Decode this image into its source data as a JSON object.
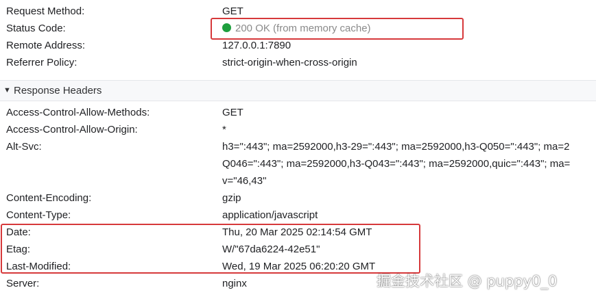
{
  "general": {
    "request_method": {
      "key": "Request Method:",
      "value": "GET"
    },
    "status_code": {
      "key": "Status Code:",
      "value": "200 OK (from memory cache)",
      "status_color": "#1e9f3e"
    },
    "remote_address": {
      "key": "Remote Address:",
      "value": "127.0.0.1:7890"
    },
    "referrer_policy": {
      "key": "Referrer Policy:",
      "value": "strict-origin-when-cross-origin"
    }
  },
  "response_headers": {
    "title": "Response Headers",
    "toggle_icon": "triangle-down",
    "allow_methods": {
      "key": "Access-Control-Allow-Methods:",
      "value": "GET"
    },
    "allow_origin": {
      "key": "Access-Control-Allow-Origin:",
      "value": "*"
    },
    "alt_svc": {
      "key": "Alt-Svc:",
      "lines": [
        "h3=\":443\"; ma=2592000,h3-29=\":443\"; ma=2592000,h3-Q050=\":443\"; ma=2",
        "Q046=\":443\"; ma=2592000,h3-Q043=\":443\"; ma=2592000,quic=\":443\"; ma=",
        "v=\"46,43\""
      ]
    },
    "content_encoding": {
      "key": "Content-Encoding:",
      "value": "gzip"
    },
    "content_type": {
      "key": "Content-Type:",
      "value": "application/javascript"
    },
    "date": {
      "key": "Date:",
      "value": "Thu, 20 Mar 2025 02:14:54 GMT"
    },
    "etag": {
      "key": "Etag:",
      "value": "W/\"67da6224-42e51\""
    },
    "last_modified": {
      "key": "Last-Modified:",
      "value": "Wed, 19 Mar 2025 06:20:20 GMT"
    },
    "server": {
      "key": "Server:",
      "value": "nginx"
    }
  },
  "annotation": {
    "highlight_color": "#d6383a"
  },
  "watermark": {
    "text": "掘金技术社区 @ puppy0_0"
  }
}
